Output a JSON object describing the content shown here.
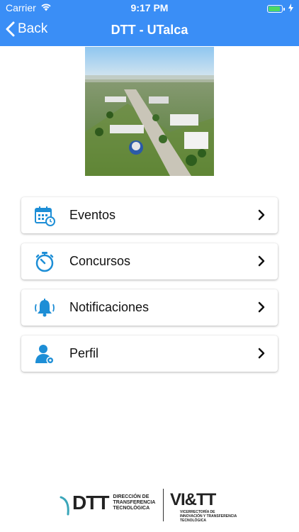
{
  "status_bar": {
    "carrier": "Carrier",
    "time": "9:17 PM"
  },
  "navbar": {
    "back_label": "Back",
    "title": "DTT - UTalca"
  },
  "menu": {
    "items": [
      {
        "label": "Eventos",
        "icon": "calendar-clock-icon"
      },
      {
        "label": "Concursos",
        "icon": "stopwatch-icon"
      },
      {
        "label": "Notificaciones",
        "icon": "bell-icon"
      },
      {
        "label": "Perfil",
        "icon": "user-settings-icon"
      }
    ]
  },
  "footer": {
    "dtt_mark": "DTT",
    "dtt_desc_1": "DIRECCIÓN DE",
    "dtt_desc_2": "TRANSFERENCIA",
    "dtt_desc_3": "TECNOLÓGICA",
    "vitt_mark": "VI&TT",
    "vitt_desc_1": "VICERRECTORÍA DE",
    "vitt_desc_2": "INNOVACIÓN Y TRANSFERENCIA",
    "vitt_desc_3": "TECNOLÓGICA"
  },
  "colors": {
    "accent": "#3a8ef6",
    "icon_blue": "#1d8ed6",
    "battery_green": "#4cd964"
  }
}
